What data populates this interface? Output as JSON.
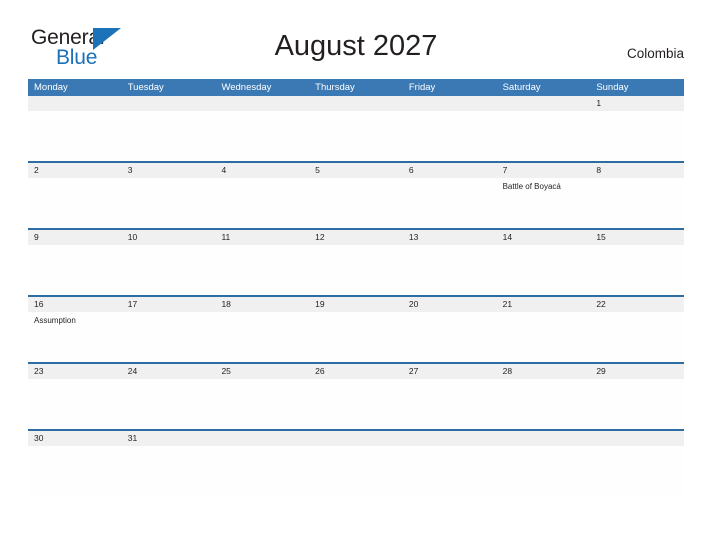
{
  "brand": {
    "name_part1": "General",
    "name_part2": "Blue",
    "accent_color": "#1b72b8"
  },
  "header": {
    "title": "August 2027",
    "country": "Colombia"
  },
  "theme": {
    "header_blue": "#3b79b5",
    "row_border_blue": "#2e6da4",
    "date_strip_gray": "#eff0ef",
    "text_color": "#231f20"
  },
  "calendar": {
    "weekdays": [
      "Monday",
      "Tuesday",
      "Wednesday",
      "Thursday",
      "Friday",
      "Saturday",
      "Sunday"
    ],
    "weeks": [
      {
        "days": [
          {
            "num": "",
            "event": ""
          },
          {
            "num": "",
            "event": ""
          },
          {
            "num": "",
            "event": ""
          },
          {
            "num": "",
            "event": ""
          },
          {
            "num": "",
            "event": ""
          },
          {
            "num": "",
            "event": ""
          },
          {
            "num": "1",
            "event": ""
          }
        ]
      },
      {
        "days": [
          {
            "num": "2",
            "event": ""
          },
          {
            "num": "3",
            "event": ""
          },
          {
            "num": "4",
            "event": ""
          },
          {
            "num": "5",
            "event": ""
          },
          {
            "num": "6",
            "event": ""
          },
          {
            "num": "7",
            "event": "Battle of Boyacá"
          },
          {
            "num": "8",
            "event": ""
          }
        ]
      },
      {
        "days": [
          {
            "num": "9",
            "event": ""
          },
          {
            "num": "10",
            "event": ""
          },
          {
            "num": "11",
            "event": ""
          },
          {
            "num": "12",
            "event": ""
          },
          {
            "num": "13",
            "event": ""
          },
          {
            "num": "14",
            "event": ""
          },
          {
            "num": "15",
            "event": ""
          }
        ]
      },
      {
        "days": [
          {
            "num": "16",
            "event": "Assumption"
          },
          {
            "num": "17",
            "event": ""
          },
          {
            "num": "18",
            "event": ""
          },
          {
            "num": "19",
            "event": ""
          },
          {
            "num": "20",
            "event": ""
          },
          {
            "num": "21",
            "event": ""
          },
          {
            "num": "22",
            "event": ""
          }
        ]
      },
      {
        "days": [
          {
            "num": "23",
            "event": ""
          },
          {
            "num": "24",
            "event": ""
          },
          {
            "num": "25",
            "event": ""
          },
          {
            "num": "26",
            "event": ""
          },
          {
            "num": "27",
            "event": ""
          },
          {
            "num": "28",
            "event": ""
          },
          {
            "num": "29",
            "event": ""
          }
        ]
      },
      {
        "days": [
          {
            "num": "30",
            "event": ""
          },
          {
            "num": "31",
            "event": ""
          },
          {
            "num": "",
            "event": ""
          },
          {
            "num": "",
            "event": ""
          },
          {
            "num": "",
            "event": ""
          },
          {
            "num": "",
            "event": ""
          },
          {
            "num": "",
            "event": ""
          }
        ]
      }
    ]
  }
}
